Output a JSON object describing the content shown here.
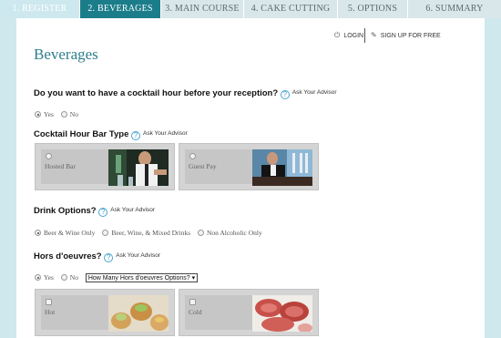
{
  "steps": [
    {
      "label": "1. REGISTER",
      "state": "done"
    },
    {
      "label": "2. BEVERAGES",
      "state": "active"
    },
    {
      "label": "3. MAIN COURSE",
      "state": "todo"
    },
    {
      "label": "4. CAKE CUTTING",
      "state": "todo"
    },
    {
      "label": "5. OPTIONS",
      "state": "todo"
    },
    {
      "label": "6. SUMMARY",
      "state": "todo"
    }
  ],
  "account": {
    "login": "LOGIN",
    "signup": "SIGN UP FOR FREE",
    "login_icon": "power-icon",
    "signup_icon": "edit-icon"
  },
  "page_title": "Beverages",
  "advisor_label": "Ask Your Advisor",
  "cocktail_hour": {
    "question": "Do you want to have a cocktail hour before your reception?",
    "options": [
      "Yes",
      "No"
    ],
    "selected": "Yes"
  },
  "bar_type": {
    "question": "Cocktail Hour Bar Type",
    "options": [
      {
        "label": "Hosted Bar",
        "image": "bartender-pouring-photo"
      },
      {
        "label": "Guest Pay",
        "image": "man-at-bar-photo"
      }
    ]
  },
  "drink_options": {
    "question": "Drink Options?",
    "options": [
      "Beer & Wine Only",
      "Beer, Wine, & Mixed Drinks",
      "Non Alcoholic Only"
    ],
    "selected": "Beer & Wine Only"
  },
  "hors_doeuvres": {
    "question": "Hors d'oeuvres?",
    "options": [
      "Yes",
      "No"
    ],
    "selected": "Yes",
    "select_value": "How Many Hors d'oeuvres Options?",
    "cards": [
      {
        "label": "Hot",
        "image": "pastry-appetizers-photo"
      },
      {
        "label": "Cold",
        "image": "cold-cuts-platter-photo"
      }
    ]
  },
  "colors": {
    "accent": "#1b7d8a",
    "title": "#2e7e8c",
    "background": "#cfe8ee",
    "help": "#4aa4cf"
  }
}
